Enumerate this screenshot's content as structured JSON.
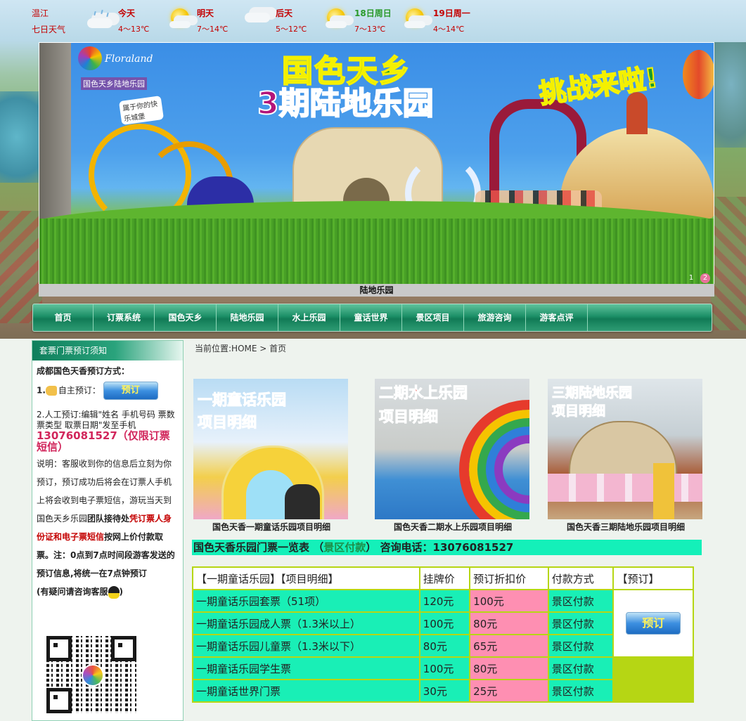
{
  "weather": {
    "city": "温江",
    "label": "七日天气",
    "days": [
      {
        "day": "今天",
        "temp": "4～13℃",
        "icon": "cloud-rain-icon"
      },
      {
        "day": "明天",
        "temp": "7～14℃",
        "icon": "sun-cloud-icon"
      },
      {
        "day": "后天",
        "temp": "5～12℃",
        "icon": "cloud-icon"
      },
      {
        "day": "18日周日",
        "temp": "7～13℃",
        "icon": "sun-cloud-icon"
      },
      {
        "day": "19日周一",
        "temp": "4～14℃",
        "icon": "sun-cloud-icon"
      }
    ]
  },
  "banner": {
    "logo_en": "Floraland",
    "logo_cn": "国色天乡陆地乐园",
    "logo_tag": "属于你的快乐城堡",
    "title_line1": "国色天乡",
    "title_line2": "3期陆地乐园",
    "slogan": "挑战来啦!",
    "caption": "陆地乐园",
    "pager": [
      "1",
      "2"
    ],
    "active_page": 2
  },
  "nav": [
    "首页",
    "订票系统",
    "国色天乡",
    "陆地乐园",
    "水上乐园",
    "童话世界",
    "景区项目",
    "旅游咨询",
    "游客点评"
  ],
  "sidebar": {
    "header": "套票门票预订须知",
    "intro": "成都国色天香预订方式：",
    "step1_label": "1.",
    "step1_text": "自主预订：",
    "book_button": "预订",
    "step2": "2.人工预订:编辑\"姓名 手机号码 票数 票类型 取票日期\"发至手机",
    "phone": "13076081527（仅限订票短信）",
    "note_a": "说明：客服收到你的信息后立刻为你预订，预订成功后将会在订票人手机上将会收到电子票短信，游玩当天到国色天乡乐园",
    "note_b": "团队接待处",
    "note_c": "凭订票人身份证和电子票短信",
    "note_d": "按网上价付款取票。注：0点到7点时间段游客发送的预订信息,将统一在7点钟预订",
    "contact_pre": "(有疑问请咨询客服",
    "contact_post": ")"
  },
  "breadcrumb": {
    "prefix": "当前位置:",
    "home": "HOME",
    "sep": " > ",
    "current": "首页"
  },
  "cards": [
    {
      "title_l1": "一期童话乐园",
      "title_l2": "项目明细",
      "caption": "国色天香一期童话乐园项目明细"
    },
    {
      "title_l1": "二期水上乐园",
      "title_l2": "项目明细",
      "caption": "国色天香二期水上乐园项目明细"
    },
    {
      "title_l1": "三期陆地乐园",
      "title_l2": "项目明细",
      "caption": "国色天香三期陆地乐园项目明细"
    }
  ],
  "price_header": {
    "title": "国色天香乐园门票一览表",
    "paren_open": "（",
    "pay": "景区付款",
    "paren_close": "）",
    "contact_label": "咨询电话：",
    "phone": "13076081527"
  },
  "table": {
    "columns": [
      "【一期童话乐园】【项目明细】",
      "挂牌价",
      "预订折扣价",
      "付款方式",
      "【预订】"
    ],
    "book_button": "预订",
    "rows": [
      {
        "name": "一期童话乐园套票（51项）",
        "list": "120元",
        "discount": "100元",
        "pay": "景区付款"
      },
      {
        "name": "一期童话乐园成人票（1.3米以上）",
        "list": "100元",
        "discount": "80元",
        "pay": "景区付款"
      },
      {
        "name": "一期童话乐园儿童票（1.3米以下）",
        "list": "80元",
        "discount": "65元",
        "pay": "景区付款"
      },
      {
        "name": "一期童话乐园学生票",
        "list": "100元",
        "discount": "80元",
        "pay": "景区付款"
      },
      {
        "name": "一期童话世界门票",
        "list": "30元",
        "discount": "25元",
        "pay": "景区付款"
      }
    ]
  }
}
